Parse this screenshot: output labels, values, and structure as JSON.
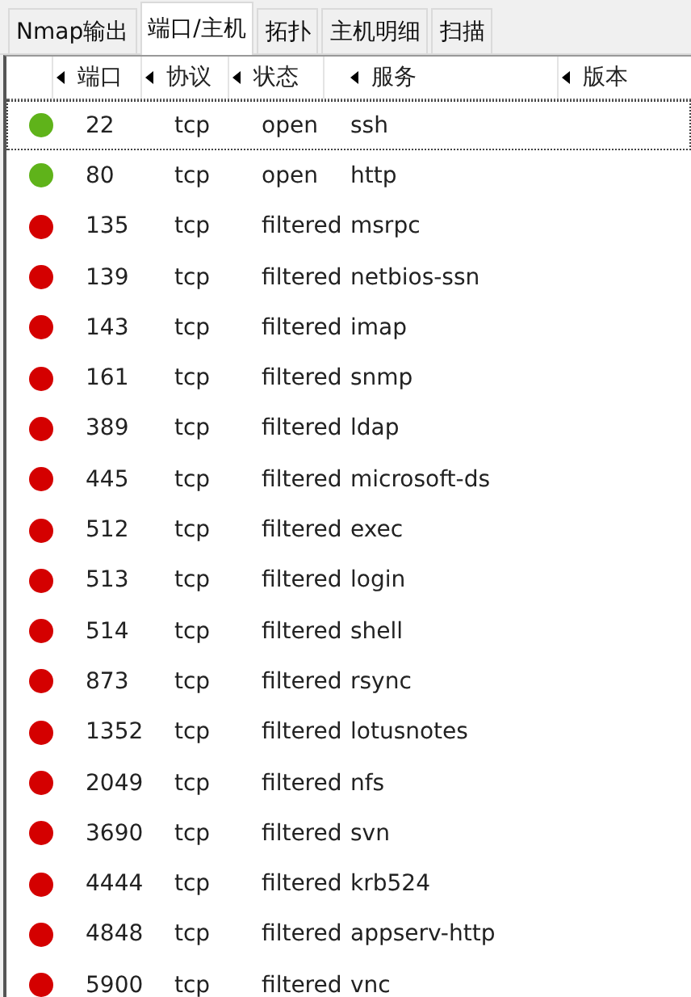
{
  "tabs": [
    {
      "label": "Nmap输出",
      "selected": false
    },
    {
      "label": "端口/主机",
      "selected": true
    },
    {
      "label": "拓扑",
      "selected": false
    },
    {
      "label": "主机明细",
      "selected": false
    },
    {
      "label": "扫描",
      "selected": false
    }
  ],
  "table": {
    "columns": [
      "端口",
      "协议",
      "状态",
      "服务",
      "版本"
    ],
    "rows": [
      {
        "selected": true,
        "color": "#5fb31a",
        "port": "22",
        "protocol": "tcp",
        "state": "open",
        "service": "ssh"
      },
      {
        "selected": false,
        "color": "#5fb31a",
        "port": "80",
        "protocol": "tcp",
        "state": "open",
        "service": "http"
      },
      {
        "selected": false,
        "color": "#d40000",
        "port": "135",
        "protocol": "tcp",
        "state": "filtered",
        "service": "msrpc"
      },
      {
        "selected": false,
        "color": "#d40000",
        "port": "139",
        "protocol": "tcp",
        "state": "filtered",
        "service": "netbios-ssn"
      },
      {
        "selected": false,
        "color": "#d40000",
        "port": "143",
        "protocol": "tcp",
        "state": "filtered",
        "service": "imap"
      },
      {
        "selected": false,
        "color": "#d40000",
        "port": "161",
        "protocol": "tcp",
        "state": "filtered",
        "service": "snmp"
      },
      {
        "selected": false,
        "color": "#d40000",
        "port": "389",
        "protocol": "tcp",
        "state": "filtered",
        "service": "ldap"
      },
      {
        "selected": false,
        "color": "#d40000",
        "port": "445",
        "protocol": "tcp",
        "state": "filtered",
        "service": "microsoft-ds"
      },
      {
        "selected": false,
        "color": "#d40000",
        "port": "512",
        "protocol": "tcp",
        "state": "filtered",
        "service": "exec"
      },
      {
        "selected": false,
        "color": "#d40000",
        "port": "513",
        "protocol": "tcp",
        "state": "filtered",
        "service": "login"
      },
      {
        "selected": false,
        "color": "#d40000",
        "port": "514",
        "protocol": "tcp",
        "state": "filtered",
        "service": "shell"
      },
      {
        "selected": false,
        "color": "#d40000",
        "port": "873",
        "protocol": "tcp",
        "state": "filtered",
        "service": "rsync"
      },
      {
        "selected": false,
        "color": "#d40000",
        "port": "1352",
        "protocol": "tcp",
        "state": "filtered",
        "service": "lotusnotes"
      },
      {
        "selected": false,
        "color": "#d40000",
        "port": "2049",
        "protocol": "tcp",
        "state": "filtered",
        "service": "nfs"
      },
      {
        "selected": false,
        "color": "#d40000",
        "port": "3690",
        "protocol": "tcp",
        "state": "filtered",
        "service": "svn"
      },
      {
        "selected": false,
        "color": "#d40000",
        "port": "4444",
        "protocol": "tcp",
        "state": "filtered",
        "service": "krb524"
      },
      {
        "selected": false,
        "color": "#d40000",
        "port": "4848",
        "protocol": "tcp",
        "state": "filtered",
        "service": "appserv-http"
      },
      {
        "selected": false,
        "color": "#d40000",
        "port": "5900",
        "protocol": "tcp",
        "state": "filtered",
        "service": "vnc"
      }
    ]
  }
}
